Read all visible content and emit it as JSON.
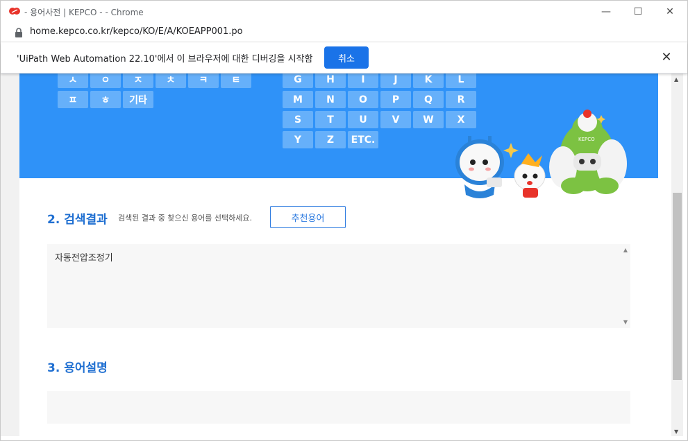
{
  "window": {
    "title": "- 용어사전 | KEPCO - - Chrome",
    "minimize": "—",
    "maximize": "☐",
    "close": "✕"
  },
  "address": {
    "url": "home.kepco.co.kr/kepco/KO/E/A/KOEAPP001.po"
  },
  "infobar": {
    "message": "'UiPath Web Automation 22.10'에서 이 브라우저에 대한 디버깅을 시작함",
    "cancel_label": "취소",
    "close_label": "✕"
  },
  "korean_keys": {
    "row1": [
      "ㅅ",
      "ㅇ",
      "ㅈ",
      "ㅊ",
      "ㅋ",
      "ㅌ"
    ],
    "row2": [
      "ㅍ",
      "ㅎ",
      "기타"
    ]
  },
  "english_keys": {
    "row1": [
      "G",
      "H",
      "I",
      "J",
      "K",
      "L"
    ],
    "row2": [
      "M",
      "N",
      "O",
      "P",
      "Q",
      "R"
    ],
    "row3": [
      "S",
      "T",
      "U",
      "V",
      "W",
      "X"
    ],
    "row4": [
      "Y",
      "Z",
      "ETC."
    ]
  },
  "mascot_logo": "KEPCO",
  "search_results": {
    "title": "2. 검색결과",
    "hint": "검색된 결과 중 찾으신 용어를 선택하세요.",
    "recommend_label": "추천용어",
    "items": [
      "자동전압조정기"
    ]
  },
  "description": {
    "title": "3. 용어설명"
  },
  "colors": {
    "hero": "#2f92f8",
    "accent": "#1f6fd1",
    "infobar_button": "#1a73e8"
  }
}
